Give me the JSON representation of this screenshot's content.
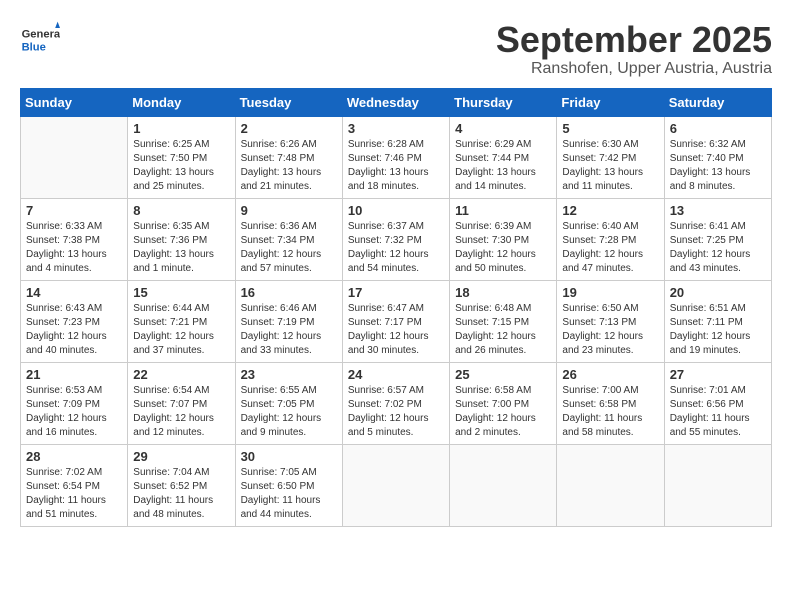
{
  "header": {
    "logo_general": "General",
    "logo_blue": "Blue",
    "title": "September 2025",
    "location": "Ranshofen, Upper Austria, Austria"
  },
  "weekdays": [
    "Sunday",
    "Monday",
    "Tuesday",
    "Wednesday",
    "Thursday",
    "Friday",
    "Saturday"
  ],
  "weeks": [
    [
      {
        "day": "",
        "info": ""
      },
      {
        "day": "1",
        "info": "Sunrise: 6:25 AM\nSunset: 7:50 PM\nDaylight: 13 hours\nand 25 minutes."
      },
      {
        "day": "2",
        "info": "Sunrise: 6:26 AM\nSunset: 7:48 PM\nDaylight: 13 hours\nand 21 minutes."
      },
      {
        "day": "3",
        "info": "Sunrise: 6:28 AM\nSunset: 7:46 PM\nDaylight: 13 hours\nand 18 minutes."
      },
      {
        "day": "4",
        "info": "Sunrise: 6:29 AM\nSunset: 7:44 PM\nDaylight: 13 hours\nand 14 minutes."
      },
      {
        "day": "5",
        "info": "Sunrise: 6:30 AM\nSunset: 7:42 PM\nDaylight: 13 hours\nand 11 minutes."
      },
      {
        "day": "6",
        "info": "Sunrise: 6:32 AM\nSunset: 7:40 PM\nDaylight: 13 hours\nand 8 minutes."
      }
    ],
    [
      {
        "day": "7",
        "info": "Sunrise: 6:33 AM\nSunset: 7:38 PM\nDaylight: 13 hours\nand 4 minutes."
      },
      {
        "day": "8",
        "info": "Sunrise: 6:35 AM\nSunset: 7:36 PM\nDaylight: 13 hours\nand 1 minute."
      },
      {
        "day": "9",
        "info": "Sunrise: 6:36 AM\nSunset: 7:34 PM\nDaylight: 12 hours\nand 57 minutes."
      },
      {
        "day": "10",
        "info": "Sunrise: 6:37 AM\nSunset: 7:32 PM\nDaylight: 12 hours\nand 54 minutes."
      },
      {
        "day": "11",
        "info": "Sunrise: 6:39 AM\nSunset: 7:30 PM\nDaylight: 12 hours\nand 50 minutes."
      },
      {
        "day": "12",
        "info": "Sunrise: 6:40 AM\nSunset: 7:28 PM\nDaylight: 12 hours\nand 47 minutes."
      },
      {
        "day": "13",
        "info": "Sunrise: 6:41 AM\nSunset: 7:25 PM\nDaylight: 12 hours\nand 43 minutes."
      }
    ],
    [
      {
        "day": "14",
        "info": "Sunrise: 6:43 AM\nSunset: 7:23 PM\nDaylight: 12 hours\nand 40 minutes."
      },
      {
        "day": "15",
        "info": "Sunrise: 6:44 AM\nSunset: 7:21 PM\nDaylight: 12 hours\nand 37 minutes."
      },
      {
        "day": "16",
        "info": "Sunrise: 6:46 AM\nSunset: 7:19 PM\nDaylight: 12 hours\nand 33 minutes."
      },
      {
        "day": "17",
        "info": "Sunrise: 6:47 AM\nSunset: 7:17 PM\nDaylight: 12 hours\nand 30 minutes."
      },
      {
        "day": "18",
        "info": "Sunrise: 6:48 AM\nSunset: 7:15 PM\nDaylight: 12 hours\nand 26 minutes."
      },
      {
        "day": "19",
        "info": "Sunrise: 6:50 AM\nSunset: 7:13 PM\nDaylight: 12 hours\nand 23 minutes."
      },
      {
        "day": "20",
        "info": "Sunrise: 6:51 AM\nSunset: 7:11 PM\nDaylight: 12 hours\nand 19 minutes."
      }
    ],
    [
      {
        "day": "21",
        "info": "Sunrise: 6:53 AM\nSunset: 7:09 PM\nDaylight: 12 hours\nand 16 minutes."
      },
      {
        "day": "22",
        "info": "Sunrise: 6:54 AM\nSunset: 7:07 PM\nDaylight: 12 hours\nand 12 minutes."
      },
      {
        "day": "23",
        "info": "Sunrise: 6:55 AM\nSunset: 7:05 PM\nDaylight: 12 hours\nand 9 minutes."
      },
      {
        "day": "24",
        "info": "Sunrise: 6:57 AM\nSunset: 7:02 PM\nDaylight: 12 hours\nand 5 minutes."
      },
      {
        "day": "25",
        "info": "Sunrise: 6:58 AM\nSunset: 7:00 PM\nDaylight: 12 hours\nand 2 minutes."
      },
      {
        "day": "26",
        "info": "Sunrise: 7:00 AM\nSunset: 6:58 PM\nDaylight: 11 hours\nand 58 minutes."
      },
      {
        "day": "27",
        "info": "Sunrise: 7:01 AM\nSunset: 6:56 PM\nDaylight: 11 hours\nand 55 minutes."
      }
    ],
    [
      {
        "day": "28",
        "info": "Sunrise: 7:02 AM\nSunset: 6:54 PM\nDaylight: 11 hours\nand 51 minutes."
      },
      {
        "day": "29",
        "info": "Sunrise: 7:04 AM\nSunset: 6:52 PM\nDaylight: 11 hours\nand 48 minutes."
      },
      {
        "day": "30",
        "info": "Sunrise: 7:05 AM\nSunset: 6:50 PM\nDaylight: 11 hours\nand 44 minutes."
      },
      {
        "day": "",
        "info": ""
      },
      {
        "day": "",
        "info": ""
      },
      {
        "day": "",
        "info": ""
      },
      {
        "day": "",
        "info": ""
      }
    ]
  ]
}
